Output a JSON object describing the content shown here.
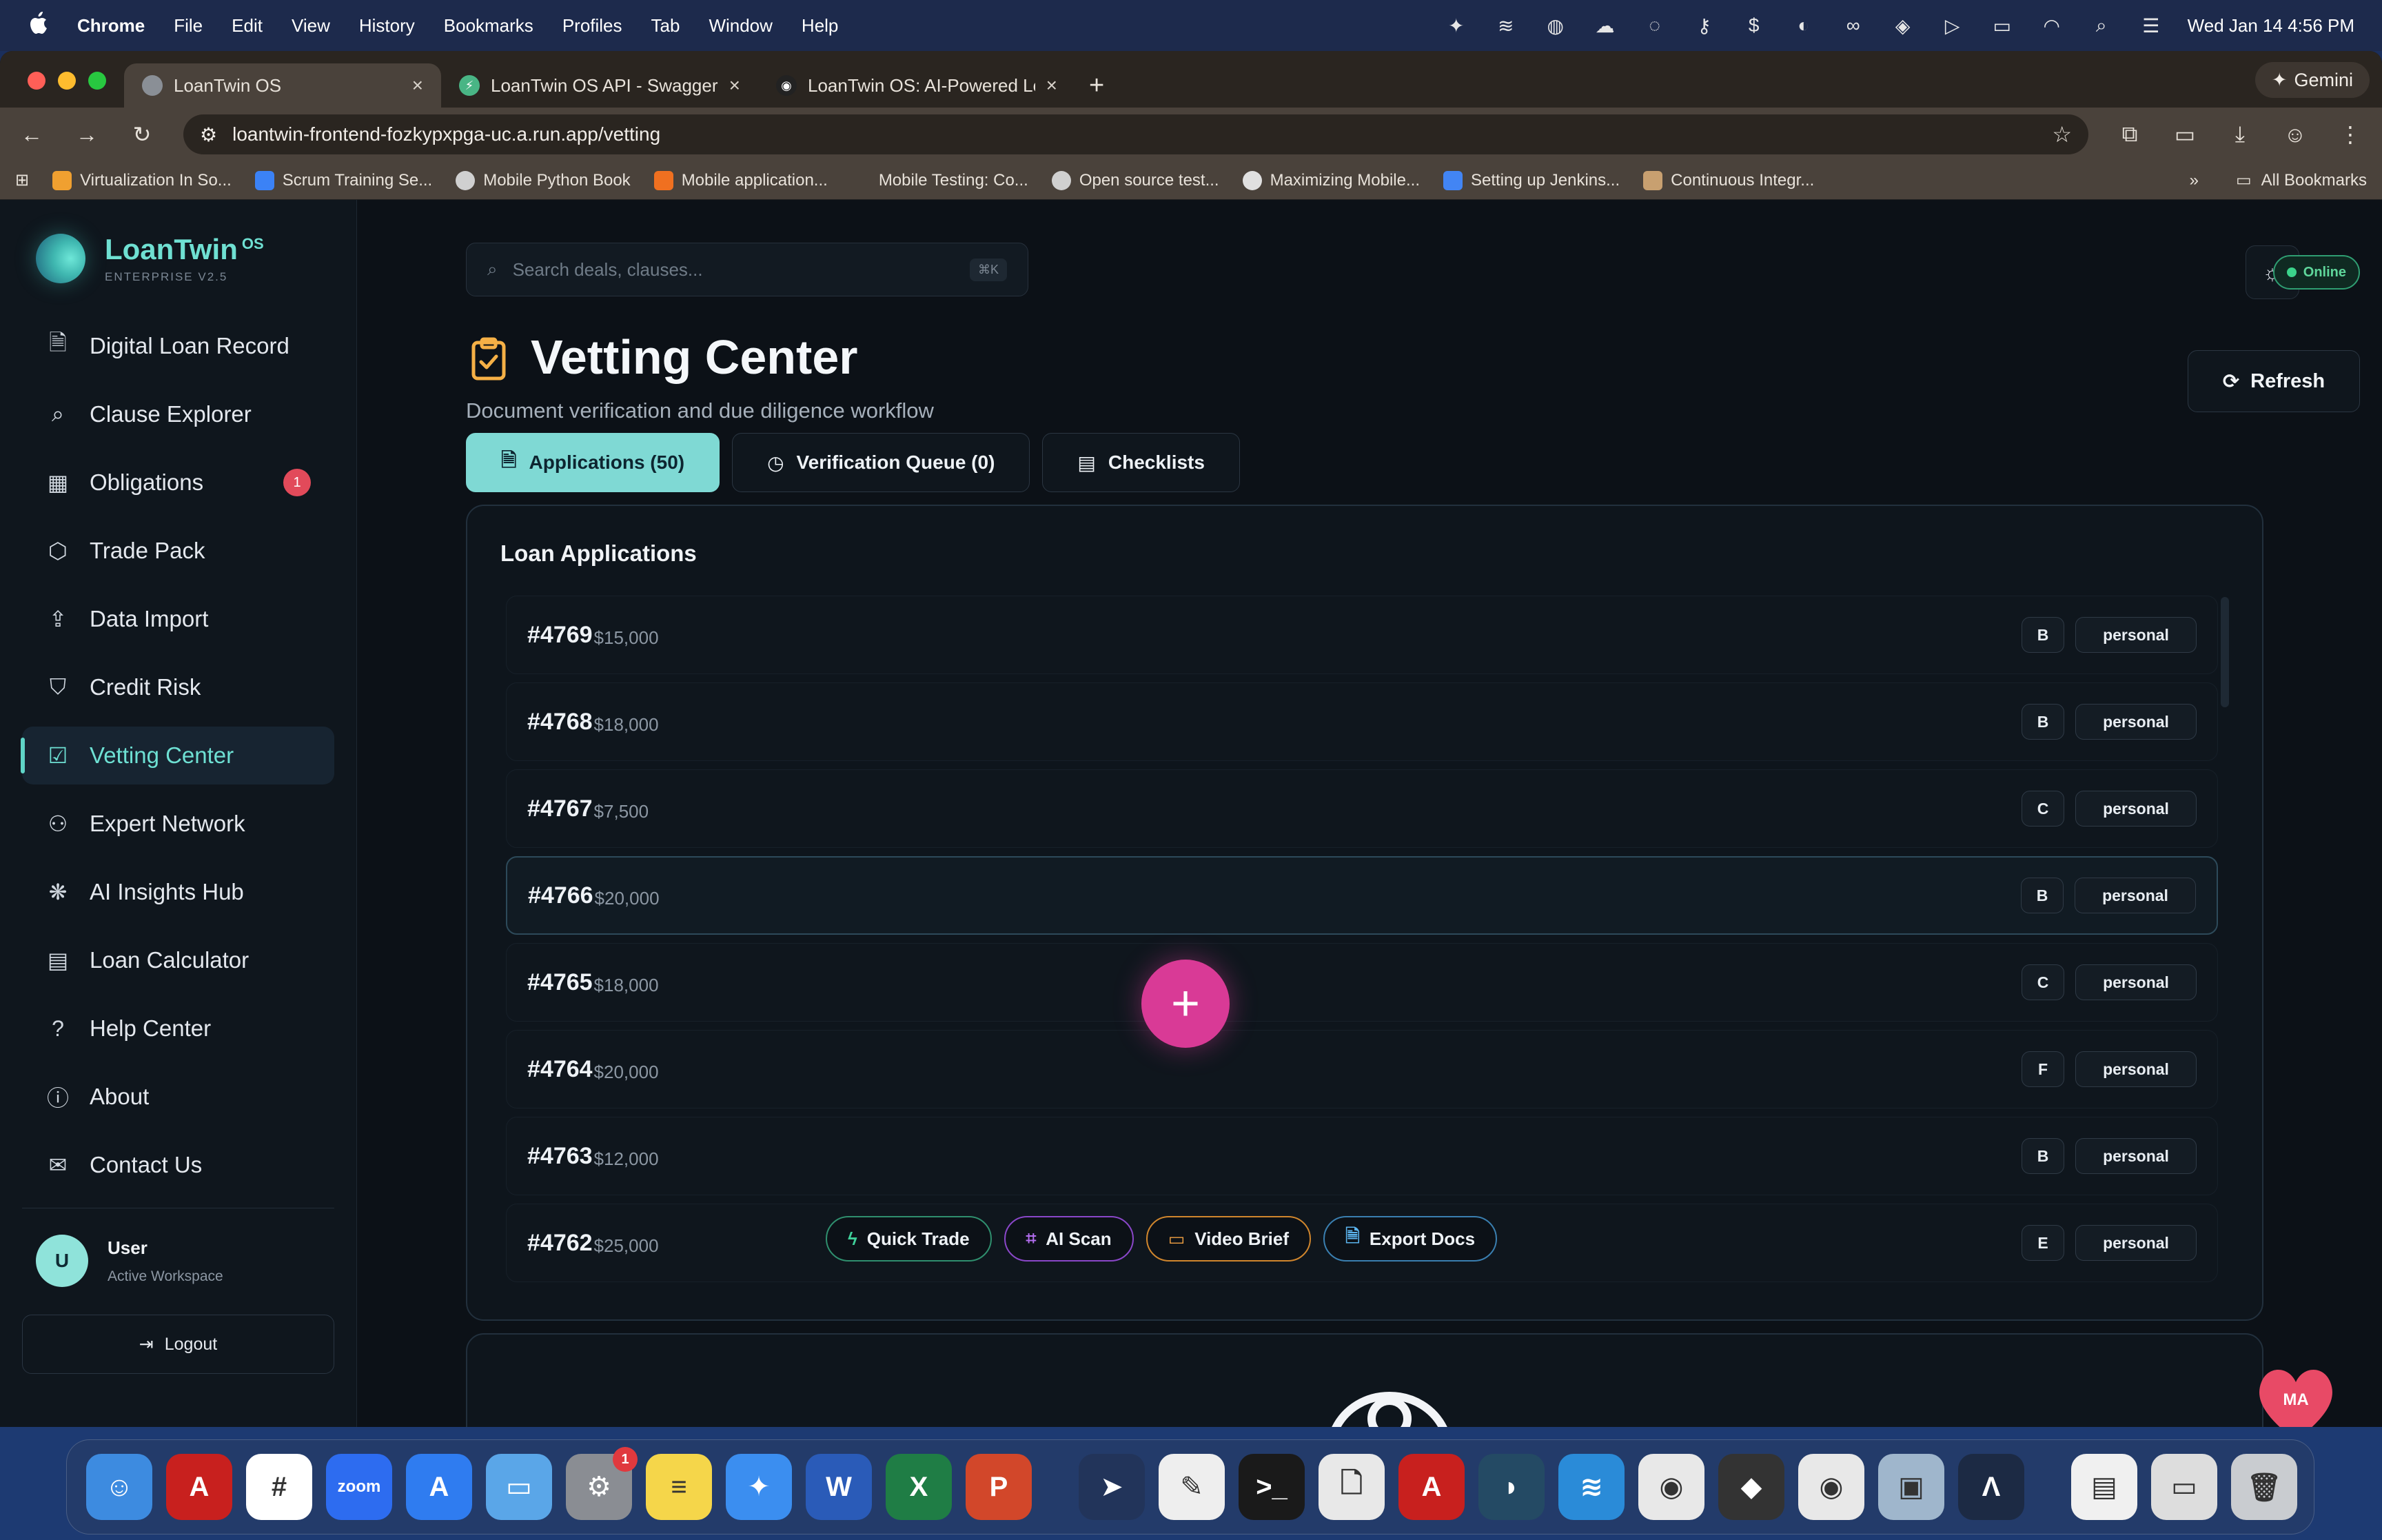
{
  "menubar": {
    "app_name": "Chrome",
    "items": [
      "File",
      "Edit",
      "View",
      "History",
      "Bookmarks",
      "Profiles",
      "Tab",
      "Window",
      "Help"
    ],
    "clock": "Wed Jan 14  4:56 PM"
  },
  "browser": {
    "tabs": [
      {
        "label": "LoanTwin OS",
        "favicon_color": "#8a8f96"
      },
      {
        "label": "LoanTwin OS API - Swagger U",
        "favicon_color": "#49b585"
      },
      {
        "label": "LoanTwin OS: AI-Powered Loa",
        "favicon_color": "#222222"
      }
    ],
    "new_tab": "+",
    "gemini_label": "Gemini",
    "url": "loantwin-frontend-fozkypxpga-uc.a.run.app/vetting",
    "bookmarks": [
      {
        "label": "Virtualization In So...",
        "color": "#f0a030"
      },
      {
        "label": "Scrum Training Se...",
        "color": "#3b82f6"
      },
      {
        "label": "Mobile Python Book",
        "color": "#d0d0d0"
      },
      {
        "label": "Mobile application...",
        "color": "#f07020"
      },
      {
        "label": "Mobile Testing: Co...",
        "color": "#4a423b"
      },
      {
        "label": "Open source test...",
        "color": "#d0d0d0"
      },
      {
        "label": "Maximizing Mobile...",
        "color": "#e0e0e0"
      },
      {
        "label": "Setting up Jenkins...",
        "color": "#4285f4"
      },
      {
        "label": "Continuous Integr...",
        "color": "#c8a070"
      }
    ],
    "more_bookmarks": "»",
    "all_bookmarks": "All Bookmarks"
  },
  "sidebar": {
    "brand": {
      "name": "LoanTwin",
      "suffix": "OS",
      "subtitle": "ENTERPRISE V2.5"
    },
    "items": [
      {
        "label": "Digital Loan Record",
        "icon": "document-icon",
        "glyph": "🗎"
      },
      {
        "label": "Clause Explorer",
        "icon": "search-icon",
        "glyph": "⌕"
      },
      {
        "label": "Obligations",
        "icon": "calendar-icon",
        "glyph": "▦",
        "badge": "1"
      },
      {
        "label": "Trade Pack",
        "icon": "package-icon",
        "glyph": "⬡"
      },
      {
        "label": "Data Import",
        "icon": "upload-icon",
        "glyph": "⇪"
      },
      {
        "label": "Credit Risk",
        "icon": "shield-icon",
        "glyph": "⛉"
      },
      {
        "label": "Vetting Center",
        "icon": "clipboard-check-icon",
        "glyph": "☑",
        "active": true
      },
      {
        "label": "Expert Network",
        "icon": "users-icon",
        "glyph": "⚇"
      },
      {
        "label": "AI Insights Hub",
        "icon": "brain-icon",
        "glyph": "❋"
      },
      {
        "label": "Loan Calculator",
        "icon": "calculator-icon",
        "glyph": "▤"
      },
      {
        "label": "Help Center",
        "icon": "help-circle-icon",
        "glyph": "?"
      },
      {
        "label": "About",
        "icon": "info-icon",
        "glyph": "ⓘ"
      },
      {
        "label": "Contact Us",
        "icon": "mail-icon",
        "glyph": "✉"
      }
    ],
    "user": {
      "initial": "U",
      "name": "User",
      "status": "Active Workspace"
    },
    "logout_label": "Logout"
  },
  "header": {
    "search_placeholder": "Search deals, clauses...",
    "search_shortcut": "⌘K",
    "status": "Online"
  },
  "page": {
    "title": "Vetting Center",
    "subtitle": "Document verification and due diligence workflow",
    "refresh_label": "Refresh",
    "tabs": [
      {
        "label": "Applications (50)",
        "active": true
      },
      {
        "label": "Verification Queue (0)"
      },
      {
        "label": "Checklists"
      }
    ]
  },
  "panel": {
    "title": "Loan Applications",
    "rows": [
      {
        "id": "#4769",
        "amount": "$15,000",
        "grade": "B",
        "type": "personal"
      },
      {
        "id": "#4768",
        "amount": "$18,000",
        "grade": "B",
        "type": "personal"
      },
      {
        "id": "#4767",
        "amount": "$7,500",
        "grade": "C",
        "type": "personal"
      },
      {
        "id": "#4766",
        "amount": "$20,000",
        "grade": "B",
        "type": "personal"
      },
      {
        "id": "#4765",
        "amount": "$18,000",
        "grade": "C",
        "type": "personal"
      },
      {
        "id": "#4764",
        "amount": "$20,000",
        "grade": "F",
        "type": "personal"
      },
      {
        "id": "#4763",
        "amount": "$12,000",
        "grade": "B",
        "type": "personal"
      },
      {
        "id": "#4762",
        "amount": "$25,000",
        "grade": "E",
        "type": "personal"
      }
    ],
    "actions": [
      "Quick Trade",
      "AI Scan",
      "Video Brief",
      "Export Docs"
    ]
  },
  "assistant": {
    "initials": "MA"
  },
  "dock": {
    "apps": [
      {
        "name": "finder",
        "color": "#3d8be0",
        "glyph": "☺"
      },
      {
        "name": "acrobat",
        "color": "#c8201e",
        "glyph": "A"
      },
      {
        "name": "slack",
        "color": "#ffffff",
        "glyph": "#"
      },
      {
        "name": "zoom",
        "color": "#2d6cf0",
        "glyph": "zoom"
      },
      {
        "name": "app-store",
        "color": "#2f7cf0",
        "glyph": "A"
      },
      {
        "name": "sidebar-app",
        "color": "#5aa6e8",
        "glyph": "▭"
      },
      {
        "name": "system-settings",
        "color": "#8a8d93",
        "glyph": "⚙",
        "badge": "1"
      },
      {
        "name": "notes",
        "color": "#f5d64a",
        "glyph": "≡"
      },
      {
        "name": "safari",
        "color": "#3b8ef0",
        "glyph": "✦"
      },
      {
        "name": "word",
        "color": "#2a5bb8",
        "glyph": "W"
      },
      {
        "name": "excel",
        "color": "#1f7d45",
        "glyph": "X"
      },
      {
        "name": "powerpoint",
        "color": "#d2472a",
        "glyph": "P"
      }
    ],
    "apps_right": [
      {
        "name": "telegram-app",
        "color": "#22345a",
        "glyph": "➤"
      },
      {
        "name": "textedit",
        "color": "#eeeeee",
        "glyph": "✎"
      },
      {
        "name": "terminal",
        "color": "#1a1a1a",
        "glyph": ">_"
      },
      {
        "name": "files",
        "color": "#e8e8e8",
        "glyph": "🗋"
      },
      {
        "name": "acrobat-2",
        "color": "#c8201e",
        "glyph": "A"
      },
      {
        "name": "wireshark",
        "color": "#244a64",
        "glyph": "◗"
      },
      {
        "name": "docker",
        "color": "#2a8bd8",
        "glyph": "≋"
      },
      {
        "name": "chrome",
        "color": "#e8e8e8",
        "glyph": "◉"
      },
      {
        "name": "cube-app",
        "color": "#333333",
        "glyph": "◆"
      },
      {
        "name": "chrome-2",
        "color": "#e8e8e8",
        "glyph": "◉"
      },
      {
        "name": "preview",
        "color": "#9fb6cc",
        "glyph": "▣"
      },
      {
        "name": "arc-app",
        "color": "#1c2a44",
        "glyph": "Λ"
      }
    ],
    "apps_end": [
      {
        "name": "document-stack",
        "color": "#f0f0f0",
        "glyph": "▤"
      },
      {
        "name": "screenshot-stack",
        "color": "#dddddd",
        "glyph": "▭"
      },
      {
        "name": "trash",
        "color": "#c9ccd0",
        "glyph": "🗑"
      }
    ]
  }
}
